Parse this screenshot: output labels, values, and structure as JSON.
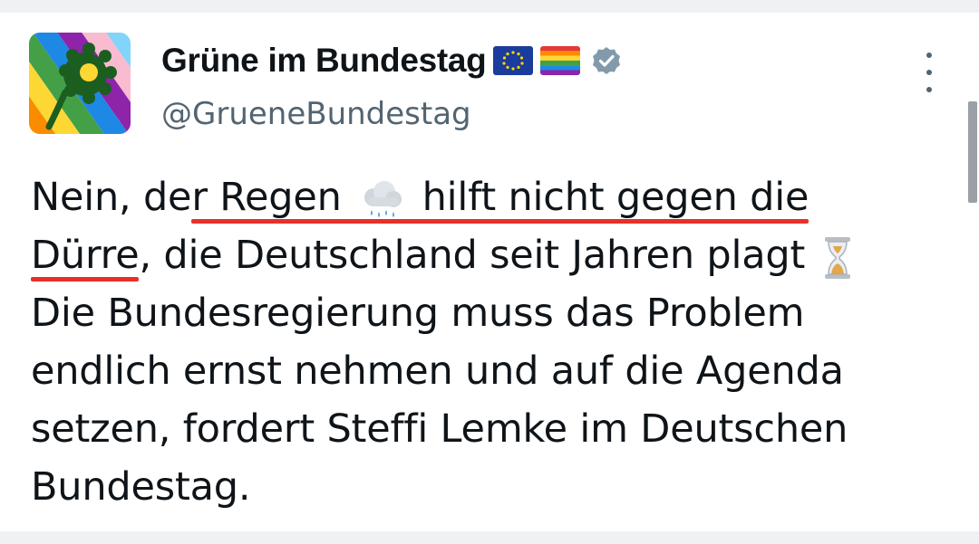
{
  "tweet": {
    "display_name": "Grüne im Bundestag",
    "handle": "@GrueneBundestag",
    "name_badges": [
      "eu-flag",
      "rainbow-flag",
      "verified-badge"
    ],
    "text_lines": [
      [
        "Nein, de",
        "r Regen",
        "",
        "hilft nicht gegen die"
      ],
      [
        "Dürre",
        ", die Deutschland seit Jahren plagt"
      ],
      [
        "Die Bundesregierung muss das Problem"
      ],
      [
        "endlich ernst nehmen und auf die Agenda"
      ],
      [
        "setzen, fordert Steffi Lemke im Deutschen"
      ],
      [
        "Bundestag."
      ]
    ],
    "inline_emojis": [
      "cloud-with-rain-icon",
      "hourglass-icon"
    ],
    "highlight_color": "#e8302a"
  }
}
